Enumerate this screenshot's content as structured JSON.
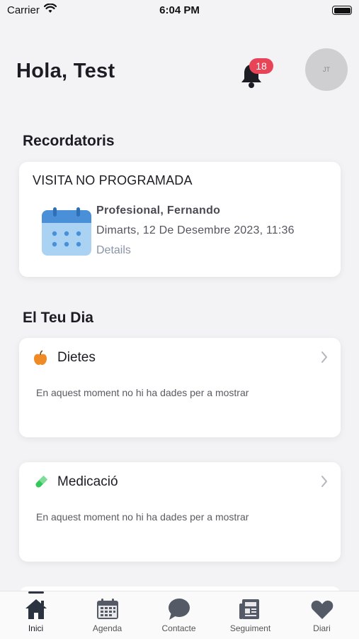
{
  "status_bar": {
    "carrier": "Carrier",
    "time": "6:04 PM"
  },
  "header": {
    "greeting": "Hola, Test",
    "notification_count": "18",
    "avatar_initials": "JT"
  },
  "reminders": {
    "title": "Recordatoris",
    "card": {
      "type": "VISITA NO PROGRAMADA",
      "professional": "Profesional, Fernando",
      "datetime": "Dimarts, 12 De Desembre 2023, 11:36",
      "details_link": "Details"
    }
  },
  "your_day": {
    "title": "El Teu Dia",
    "cards": [
      {
        "title": "Dietes",
        "icon": "apple-icon",
        "message": "En aquest moment no hi ha dades per a mostrar"
      },
      {
        "title": "Medicació",
        "icon": "pill-icon",
        "message": "En aquest moment no hi ha dades per a mostrar"
      }
    ]
  },
  "tab_bar": {
    "items": [
      {
        "label": "Inici",
        "icon": "home-icon",
        "active": true
      },
      {
        "label": "Agenda",
        "icon": "calendar-icon"
      },
      {
        "label": "Contacte",
        "icon": "chat-icon"
      },
      {
        "label": "Seguiment",
        "icon": "newspaper-icon"
      },
      {
        "label": "Diari",
        "icon": "heart-icon"
      }
    ]
  },
  "colors": {
    "badge": "#e74458",
    "calendar_blue": "#4a90d9",
    "apple_orange": "#f08a24",
    "pill_green": "#34c759"
  }
}
